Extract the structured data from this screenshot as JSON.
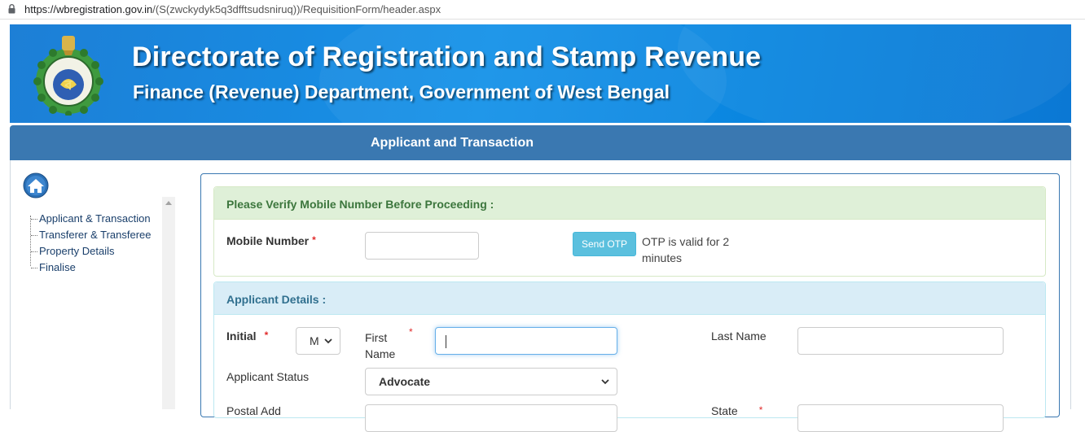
{
  "browser": {
    "url_host": "https://wbregistration.gov.in",
    "url_path": "/(S(zwckydyk5q3dfftsudsniruq))/RequisitionForm/header.aspx"
  },
  "header": {
    "title": "Directorate of Registration and Stamp Revenue",
    "subtitle": "Finance (Revenue) Department, Government of West Bengal"
  },
  "section": {
    "title": "Applicant and Transaction"
  },
  "sidebar": {
    "items": [
      {
        "label": "Applicant & Transaction"
      },
      {
        "label": "Transferer & Transferee"
      },
      {
        "label": "Property Details"
      },
      {
        "label": "Finalise"
      }
    ]
  },
  "verify": {
    "heading": "Please Verify Mobile Number Before Proceeding :",
    "mobile_label": "Mobile Number",
    "mobile_value": "",
    "send_otp_label": "Send OTP",
    "otp_note": "OTP is valid for 2 minutes"
  },
  "applicant": {
    "heading": "Applicant Details :",
    "initial_label": "Initial",
    "initial_value": "M",
    "first_name_label": "First Name",
    "first_name_value": "",
    "last_name_label": "Last Name",
    "last_name_value": "",
    "status_label": "Applicant Status",
    "status_value": "Advocate",
    "postal_label_partial": "Postal Add",
    "state_label_partial": "State"
  },
  "required_marker": "*",
  "colors": {
    "banner": "#1592e8",
    "section_bar": "#3a78b1",
    "verify_head": "#dff0d8",
    "applicant_head": "#d9edf7",
    "otp_button": "#5bc0de",
    "required": "#e12b2b"
  }
}
